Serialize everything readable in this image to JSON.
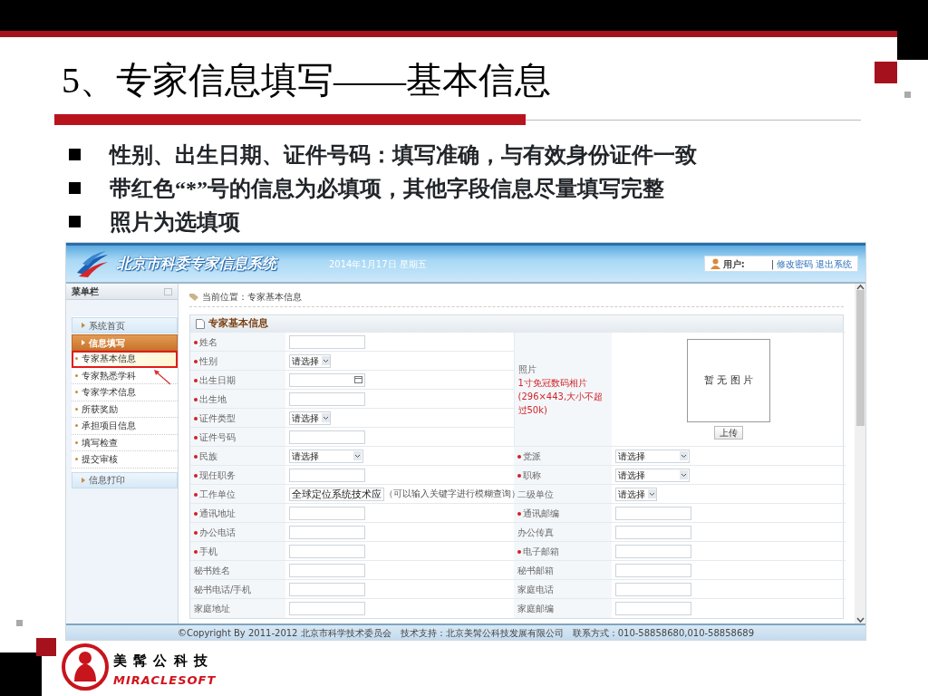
{
  "slide": {
    "title": "5、专家信息填写——基本信息",
    "bullets": [
      "性别、出生日期、证件号码：填写准确，与有效身份证件一致",
      "带红色“*”号的信息为必填项，其他字段信息尽量填写完整",
      "照片为选填项"
    ],
    "logo": {
      "name": "美 髯 公 科 技",
      "latin": "MIRACLESOFT"
    }
  },
  "app": {
    "system_title": "北京市科委专家信息系统",
    "date": "2014年1月17日 星期五",
    "user_label": "用户:",
    "separator": "|",
    "links": [
      {
        "label": "修改密码"
      },
      {
        "label": "退出系统"
      }
    ],
    "sidebar": {
      "title": "菜单栏",
      "groups": [
        {
          "label": "系统首页",
          "expanded": false
        },
        {
          "label": "信息填写",
          "expanded": true,
          "children": [
            {
              "label": "专家基本信息",
              "selected": true,
              "annotated": true
            },
            {
              "label": "专家熟悉学科",
              "selected": false,
              "annotated": false
            },
            {
              "label": "专家学术信息",
              "selected": false,
              "annotated": false
            },
            {
              "label": "所获奖励",
              "selected": false,
              "annotated": false
            },
            {
              "label": "承担项目信息",
              "selected": false,
              "annotated": false
            },
            {
              "label": "填写检查",
              "selected": false,
              "annotated": false
            },
            {
              "label": "提交审核",
              "selected": false,
              "annotated": false
            }
          ]
        },
        {
          "label": "信息打印",
          "expanded": false
        }
      ]
    },
    "breadcrumb": "当前位置：专家基本信息",
    "form": {
      "title": "专家基本信息",
      "photo": {
        "label": "照片",
        "note": "1寸免冠数码相片(296×443,大小不超过50k)",
        "placeholder": "暂 无 图 片",
        "button": "上传"
      },
      "rows": [
        {
          "left": {
            "label": "姓名",
            "required": true,
            "kind": "text"
          }
        },
        {
          "left": {
            "label": "性别",
            "required": true,
            "kind": "select",
            "value": "请选择",
            "wide": false
          }
        },
        {
          "left": {
            "label": "出生日期",
            "required": true,
            "kind": "date"
          }
        },
        {
          "left": {
            "label": "出生地",
            "required": true,
            "kind": "text"
          }
        },
        {
          "left": {
            "label": "证件类型",
            "required": true,
            "kind": "select",
            "value": "请选择",
            "wide": false
          }
        },
        {
          "left": {
            "label": "证件号码",
            "required": true,
            "kind": "text"
          }
        },
        {
          "left": {
            "label": "民族",
            "required": true,
            "kind": "select",
            "value": "请选择",
            "wide": true
          },
          "right": {
            "label": "党派",
            "required": true,
            "kind": "select",
            "value": "请选择",
            "wide": true
          }
        },
        {
          "left": {
            "label": "现任职务",
            "required": true,
            "kind": "text"
          },
          "right": {
            "label": "职称",
            "required": true,
            "kind": "select",
            "value": "请选择",
            "wide": true
          }
        },
        {
          "left": {
            "label": "工作单位",
            "required": true,
            "kind": "text",
            "value": "全球定位系统技术应",
            "hint": "（可以输入关键字进行模糊查询）"
          },
          "right": {
            "label": "二级单位",
            "required": false,
            "kind": "select",
            "value": "请选择",
            "wide": false
          }
        },
        {
          "left": {
            "label": "通讯地址",
            "required": true,
            "kind": "text"
          },
          "right": {
            "label": "通讯邮编",
            "required": true,
            "kind": "text"
          }
        },
        {
          "left": {
            "label": "办公电话",
            "required": true,
            "kind": "text"
          },
          "right": {
            "label": "办公传真",
            "required": false,
            "kind": "text"
          }
        },
        {
          "left": {
            "label": "手机",
            "required": true,
            "kind": "text"
          },
          "right": {
            "label": "电子邮箱",
            "required": true,
            "kind": "text"
          }
        },
        {
          "left": {
            "label": "秘书姓名",
            "required": false,
            "kind": "text"
          },
          "right": {
            "label": "秘书邮箱",
            "required": false,
            "kind": "text"
          }
        },
        {
          "left": {
            "label": "秘书电话/手机",
            "required": false,
            "kind": "text"
          },
          "right": {
            "label": "家庭电话",
            "required": false,
            "kind": "text"
          }
        },
        {
          "left": {
            "label": "家庭地址",
            "required": false,
            "kind": "text"
          },
          "right": {
            "label": "家庭邮编",
            "required": false,
            "kind": "text"
          }
        }
      ]
    },
    "footer": "©Copyright By 2011-2012 北京市科学技术委员会　技术支持：北京美髯公科技发展有限公司　联系方式：010-58858680,010-58858689"
  }
}
